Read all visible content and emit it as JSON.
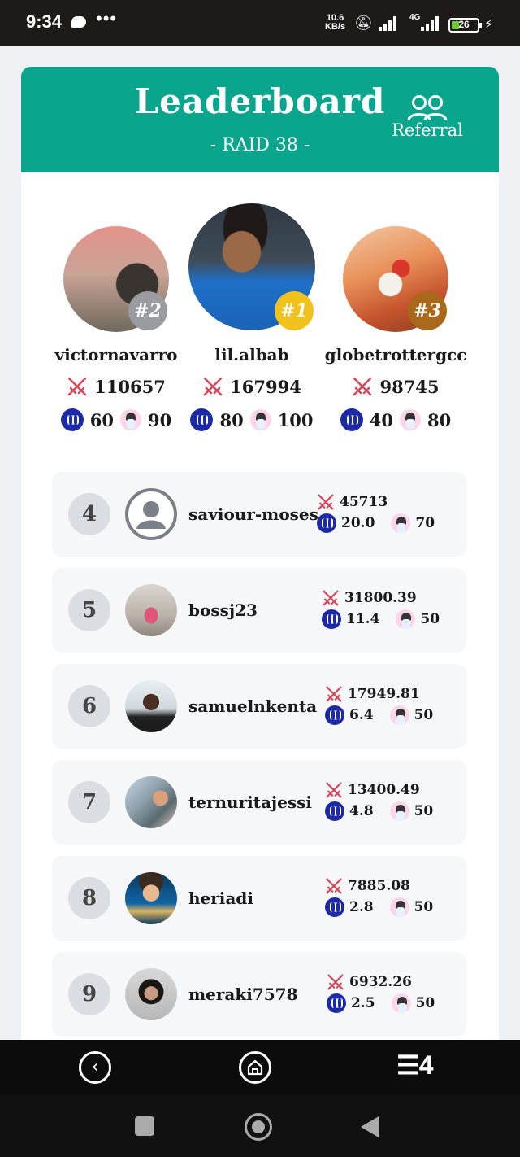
{
  "status_bar": {
    "time": "9:34",
    "net_speed_value": "10.6",
    "net_speed_unit": "KB/s",
    "network_type": "4G",
    "battery": "26"
  },
  "header": {
    "title": "Leaderboard",
    "subtitle": "- RAID 38 -",
    "referral_label": "Referral",
    "color": "#0aa58d"
  },
  "podium": [
    {
      "rank": "#2",
      "name": "victornavarro",
      "score": "110657",
      "steem": "60",
      "points": "90",
      "badge_color": "#9a9ba0"
    },
    {
      "rank": "#1",
      "name": "lil.albab",
      "score": "167994",
      "steem": "80",
      "points": "100",
      "badge_color": "#f2c21c"
    },
    {
      "rank": "#3",
      "name": "globetrottergcc",
      "score": "98745",
      "steem": "40",
      "points": "80",
      "badge_color": "#a8691a"
    }
  ],
  "list": [
    {
      "rank": "4",
      "name": "saviour-moses",
      "score": "45713",
      "steem": "20.0",
      "points": "70"
    },
    {
      "rank": "5",
      "name": "bossj23",
      "score": "31800.39",
      "steem": "11.4",
      "points": "50"
    },
    {
      "rank": "6",
      "name": "samuelnkenta",
      "score": "17949.81",
      "steem": "6.4",
      "points": "50"
    },
    {
      "rank": "7",
      "name": "ternuritajessi",
      "score": "13400.49",
      "steem": "4.8",
      "points": "50"
    },
    {
      "rank": "8",
      "name": "heriadi",
      "score": "7885.08",
      "steem": "2.8",
      "points": "50"
    },
    {
      "rank": "9",
      "name": "meraki7578",
      "score": "6932.26",
      "steem": "2.5",
      "points": "50"
    }
  ],
  "app_nav": {
    "brand": "4"
  }
}
